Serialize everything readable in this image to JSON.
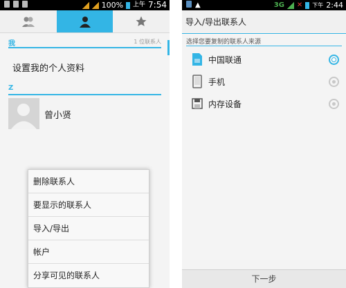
{
  "left": {
    "status": {
      "battery": "100%",
      "time_prefix": "上午",
      "time": "7:54"
    },
    "tabs": [
      {
        "icon": "groups-icon"
      },
      {
        "icon": "person-icon"
      },
      {
        "icon": "star-icon"
      }
    ],
    "section_me": {
      "header": "我",
      "count": "1 位联系人"
    },
    "setup_profile": "设置我的个人资料",
    "section_z": {
      "header": "Z"
    },
    "contact_name": "曾小贤",
    "menu": [
      "删除联系人",
      "要显示的联系人",
      "导入/导出",
      "帐户",
      "分享可见的联系人"
    ]
  },
  "right": {
    "status": {
      "net": "3G",
      "time_prefix": "下午",
      "time": "2:44"
    },
    "title": "导入/导出联系人",
    "subtitle": "选择您要复制的联系人来源",
    "sources": [
      {
        "label": "中国联通",
        "icon": "sim-card-icon",
        "selected": true
      },
      {
        "label": "手机",
        "icon": "phone-icon",
        "selected": false
      },
      {
        "label": "内存设备",
        "icon": "storage-icon",
        "selected": false
      }
    ],
    "next_button": "下一步"
  },
  "colors": {
    "accent": "#33b5e5",
    "statusbar": "#000000",
    "background": "#f4f4f4"
  }
}
